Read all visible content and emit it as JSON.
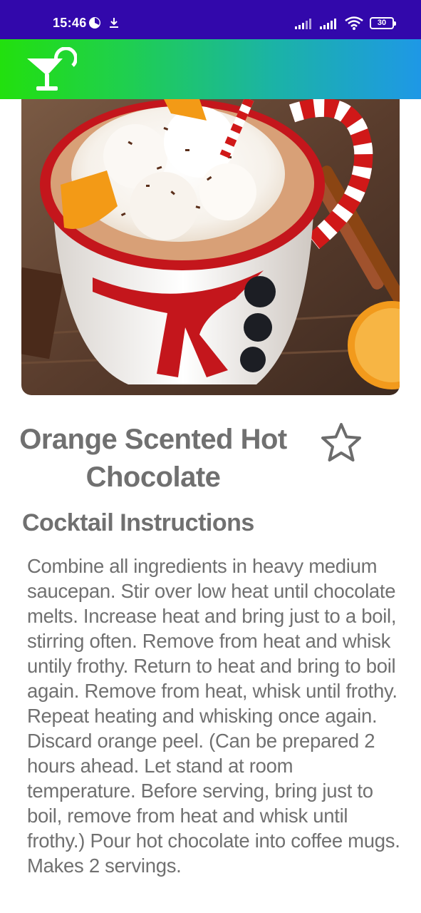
{
  "status_bar": {
    "time": "15:46",
    "battery": "30",
    "icons": [
      "alarm-icon",
      "download-icon",
      "signal-icon",
      "signal-icon",
      "wifi-icon",
      "battery-icon"
    ]
  },
  "app_bar": {
    "logo_icon": "cocktail-glass-icon",
    "colors": [
      "#22e00e",
      "#1e98e6"
    ]
  },
  "drink": {
    "title": "Orange Scented Hot Chocolate",
    "favorite_icon": "star-outline-icon"
  },
  "instructions": {
    "heading": "Cocktail Instructions",
    "text": "Combine all ingredients in heavy medium saucepan. Stir over low heat until chocolate melts. Increase heat and bring just to a boil, stirring often. Remove from heat and whisk untily frothy. Return to heat and bring to boil again. Remove from heat, whisk until frothy. Repeat heating and whisking once again. Discard orange peel. (Can be prepared 2 hours ahead. Let stand at room temperature. Before serving, bring just to boil, remove from heat and whisk until frothy.) Pour hot chocolate into coffee mugs. Makes 2 servings."
  }
}
